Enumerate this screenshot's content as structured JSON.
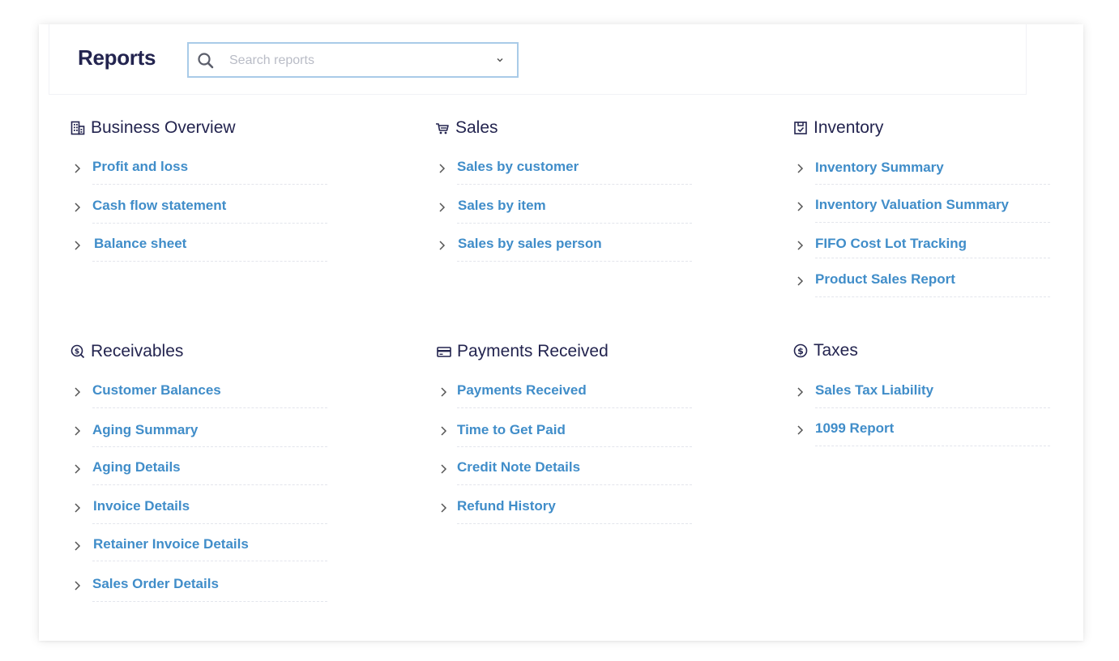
{
  "header": {
    "title": "Reports",
    "search_placeholder": "Search reports",
    "search_value": ""
  },
  "sections": [
    {
      "title": "Business Overview",
      "icon": "building-icon",
      "items": [
        {
          "label": "Profit and loss"
        },
        {
          "label": "Cash flow statement"
        },
        {
          "label": "Balance sheet"
        }
      ]
    },
    {
      "title": "Sales",
      "icon": "cart-icon",
      "items": [
        {
          "label": "Sales by customer"
        },
        {
          "label": "Sales by item"
        },
        {
          "label": "Sales by sales person"
        }
      ]
    },
    {
      "title": "Inventory",
      "icon": "clipboard-icon",
      "items": [
        {
          "label": "Inventory Summary"
        },
        {
          "label": "Inventory Valuation Summary"
        },
        {
          "label": "FIFO Cost Lot Tracking"
        },
        {
          "label": "Product Sales Report"
        }
      ]
    },
    {
      "title": "Receivables",
      "icon": "money-search-icon",
      "items": [
        {
          "label": "Customer Balances"
        },
        {
          "label": "Aging Summary"
        },
        {
          "label": "Aging Details"
        },
        {
          "label": "Invoice Details"
        },
        {
          "label": "Retainer Invoice Details"
        },
        {
          "label": "Sales Order Details"
        }
      ]
    },
    {
      "title": "Payments Received",
      "icon": "credit-card-icon",
      "items": [
        {
          "label": "Payments Received"
        },
        {
          "label": "Time to Get Paid"
        },
        {
          "label": "Credit Note Details"
        },
        {
          "label": "Refund History"
        }
      ]
    },
    {
      "title": "Taxes",
      "icon": "dollar-circle-icon",
      "items": [
        {
          "label": "Sales Tax Liability"
        },
        {
          "label": "1099 Report"
        }
      ]
    }
  ],
  "colors": {
    "title": "#23244f",
    "link": "#408dc9",
    "search_border": "#a9cbe8"
  }
}
